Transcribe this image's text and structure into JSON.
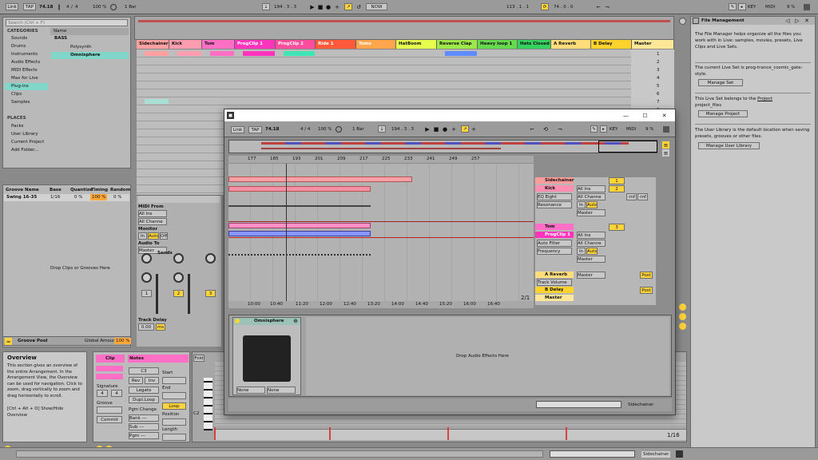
{
  "transport": {
    "link": "Link",
    "tap": "TAP",
    "tempo": "74.18",
    "sig_top": "4",
    "sig_bottom": "4",
    "zoom": "100 %",
    "quant": "1 Bar",
    "pos": "194 . 3 . 3",
    "now": "NOW",
    "loop_start": "113 . 1 . 1",
    "loop_len": "74 . 0 . 0",
    "key": "KEY",
    "midi": "MIDI",
    "cpu": "9 %",
    "draw": "D"
  },
  "browser": {
    "search_placeholder": "Search (Ctrl + F)",
    "categories_title": "CATEGORIES",
    "name_col": "Name",
    "categories": [
      "Sounds",
      "Drums",
      "Instruments",
      "Audio Effects",
      "MIDI Effects",
      "Max for Live",
      "Plug-ins",
      "Clips",
      "Samples"
    ],
    "places_title": "PLACES",
    "places": [
      "Packs",
      "User Library",
      "Current Project",
      "Add Folder..."
    ],
    "tree_root": "BASS",
    "tree_items": [
      "Polysynth",
      "Omnisphere"
    ]
  },
  "groove": {
    "headers": [
      "Groove Name",
      "Base",
      "Quantize",
      "Timing",
      "Random"
    ],
    "row": {
      "name": "Swing 16-35",
      "base": "1/16",
      "quantize": "0 %",
      "timing": "100 %",
      "random": "0 %"
    },
    "drop": "Drop Clips or Grooves Here",
    "pool": "Groove Pool",
    "global": "Global Amount",
    "global_val": "100 %"
  },
  "tracks": [
    {
      "name": "Sidechainer",
      "color": "#ffa0a0"
    },
    {
      "name": "Kick",
      "color": "#ff9db0"
    },
    {
      "name": "Tom",
      "color": "#ff6fc6"
    },
    {
      "name": "ProgClip 1",
      "color": "#ff34bd"
    },
    {
      "name": "ProgClip 2",
      "color": "#ff4e9e"
    },
    {
      "name": "Ride 1",
      "color": "#ff5a3c"
    },
    {
      "name": "Toms",
      "color": "#ffa54e"
    },
    {
      "name": "HatBoom",
      "color": "#e6ff4f"
    },
    {
      "name": "Reverse Clap",
      "color": "#9fe84a"
    },
    {
      "name": "Heavy loop 1",
      "color": "#66d94f"
    },
    {
      "name": "Hats Closed",
      "color": "#37d160"
    },
    {
      "name": "A Reverb",
      "color": "#ffdd7a"
    },
    {
      "name": "B Delay",
      "color": "#ffd32c"
    },
    {
      "name": "Master",
      "color": "#ffe79a"
    }
  ],
  "scenes": [
    "1",
    "2",
    "3",
    "4",
    "5",
    "6",
    "7",
    "8"
  ],
  "mixer": {
    "midi_from": "MIDI From",
    "all_ins": "All Ins",
    "all_channels": "All Channe",
    "monitor": "Monitor",
    "in": "In",
    "auto": "Auto",
    "off": "Off",
    "audio_to": "Audio To",
    "master": "Master",
    "sends": "Sends",
    "track_delay": "Track Delay",
    "delay_val": "0.00",
    "ms": "ms",
    "track_nums": [
      "1",
      "2",
      "3"
    ]
  },
  "file_mgmt": {
    "title": "File Management",
    "p1": "The File Manager helps organize all the files you work with in Live: samples, movies, presets, Live Clips and Live Sets.",
    "p2": "The current Live Set is prog-trance_cosmic_gate-style.",
    "btn1": "Manage Set",
    "p3_a": "This Live Set belongs to the",
    "p3_link": "Project",
    "p3_b": "project_files",
    "btn2": "Manage Project",
    "p4": "The User Library is the default location when saving presets, grooves or other files.",
    "btn3": "Manage User Library"
  },
  "overview": {
    "title": "Overview",
    "text": "This section gives an overview of the entire Arrangement. In the Arrangement View, the Overview can be used for navigation. Click to zoom, drag vertically to zoom and drag horizontally to scroll.",
    "shortcut": "[Ctrl + Alt + O] Show/Hide Overview"
  },
  "clip": {
    "title": "Clip",
    "notes": "Notes",
    "signature": "Signature",
    "groove": "Groove",
    "commit": "Commit",
    "start": "Start",
    "end": "End",
    "loop": "Loop",
    "position": "Position",
    "length": "Length",
    "pgm_change": "Pgm Change",
    "bank": "Bank ---",
    "sub": "Sub ---",
    "pgm": "Pgm ---",
    "c3": "C3",
    "rev": "Rev",
    "inv": "Inv",
    "legato": "Legato",
    "dupl_loop": "Dupl.Loop",
    "sig_top": "4",
    "sig_bottom": "4",
    "fold": "Fold",
    "c2": "C2",
    "page": "1/16"
  },
  "float": {
    "link": "Link",
    "tap": "TAP",
    "tempo": "74.18",
    "sig": "4 / 4",
    "zoom": "100 %",
    "quant": "1 Bar",
    "pos": "194 . 3 . 3",
    "key": "KEY",
    "midi": "MIDI",
    "cpu": "9 %",
    "ruler": [
      "177",
      "185",
      "193",
      "201",
      "209",
      "217",
      "225",
      "233",
      "241",
      "249",
      "257"
    ],
    "times": [
      "10:00",
      "10:40",
      "11:20",
      "12:00",
      "12:40",
      "13:20",
      "14:00",
      "14:40",
      "15:20",
      "16:00",
      "16:40"
    ],
    "page": "2/1",
    "tracks": [
      {
        "name": "Sidechainer",
        "color": "#ff9c9c"
      },
      {
        "name": "Kick",
        "color": "#ff8fb0",
        "sub": "EQ Eight",
        "param": "Resonance"
      },
      {
        "name": "Tom",
        "color": "#ff6fc6"
      },
      {
        "name": "ProgClip 1",
        "color": "#ff34bd",
        "sub": "Auto Filter",
        "param": "Frequency"
      },
      {
        "name": "A Reverb",
        "color": "#ffdd7a",
        "sub": "Track Volume"
      },
      {
        "name": "B Delay",
        "color": "#ffd32c"
      },
      {
        "name": "Master",
        "color": "#ffe79a"
      }
    ],
    "all_ins": "All Ins",
    "all_channels": "All Channe",
    "in": "In",
    "auto": "Auto",
    "master": "Master",
    "inf": "-inf",
    "post": "Post",
    "device": "Omnisphere",
    "none": "None",
    "drop": "Drop Audio Effects Here",
    "sidechain": "Sidechainer"
  },
  "status": {
    "sidechain": "Sidechainer"
  }
}
